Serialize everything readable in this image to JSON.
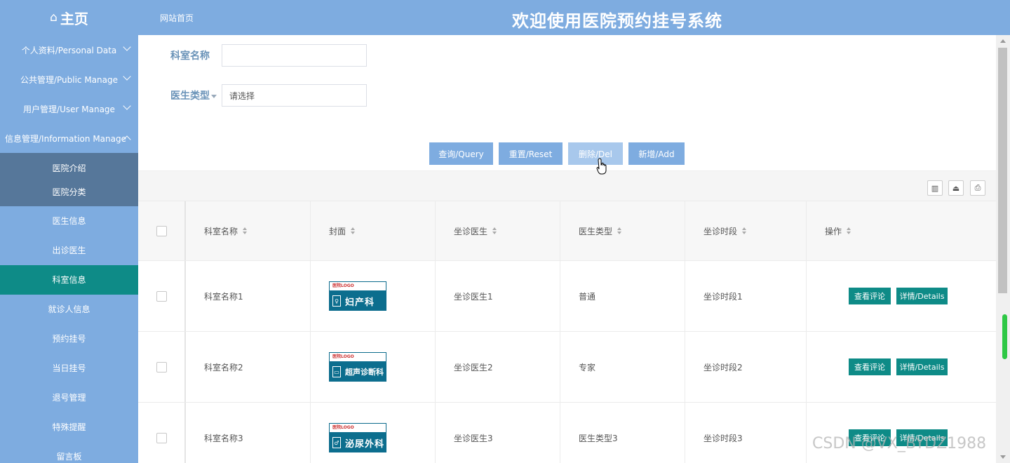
{
  "header": {
    "logo_glyph": "⌂",
    "logo_text": "主页",
    "site_home": "网站首页",
    "title": "欢迎使用医院预约挂号系统"
  },
  "sidebar": {
    "groups": [
      {
        "label": "个人资料/Personal Data"
      },
      {
        "label": "公共管理/Public Manage"
      },
      {
        "label": "用户管理/User Manage"
      },
      {
        "label": "信息管理/Information Manage"
      }
    ],
    "sub_dark": [
      {
        "label": "医院介绍"
      },
      {
        "label": "医院分类"
      }
    ],
    "sub_plain": [
      {
        "label": "医生信息"
      },
      {
        "label": "出诊医生"
      },
      {
        "label": "科室信息"
      },
      {
        "label": "就诊人信息"
      },
      {
        "label": "预约挂号"
      },
      {
        "label": "当日挂号"
      },
      {
        "label": "退号管理"
      },
      {
        "label": "特殊提醒"
      },
      {
        "label": "留言板"
      }
    ]
  },
  "search": {
    "dept_label": "科室名称",
    "dept_value": "",
    "doctor_type_label": "医生类型",
    "doctor_type_value": "请选择"
  },
  "buttons": {
    "query": "查询/Query",
    "reset": "重置/Reset",
    "delete": "删除/Del",
    "add": "新增/Add"
  },
  "toolbar": {
    "columns_icon": "▥",
    "export_icon": "⏏",
    "print_icon": "⎙"
  },
  "table": {
    "headers": {
      "dept": "科室名称",
      "cover": "封面",
      "doctor": "坐诊医生",
      "doctor_type": "医生类型",
      "period": "坐诊时段",
      "ops": "操作"
    },
    "rows": [
      {
        "dept": "科室名称1",
        "cover_logo": "医院LOGO",
        "cover_name": "妇产科",
        "doctor": "坐诊医生1",
        "doctor_type": "普通",
        "period": "坐诊时段1"
      },
      {
        "dept": "科室名称2",
        "cover_logo": "医院LOGO",
        "cover_name": "超声诊断科",
        "doctor": "坐诊医生2",
        "doctor_type": "专家",
        "period": "坐诊时段2"
      },
      {
        "dept": "科室名称3",
        "cover_logo": "医院LOGO",
        "cover_name": "泌尿外科",
        "doctor": "坐诊医生3",
        "doctor_type": "医生类型3",
        "period": "坐诊时段3"
      }
    ],
    "op_review": "查看评论",
    "op_details": "详情/Details"
  },
  "watermark": "CSDN @VX_BYDZ1988",
  "colors": {
    "primary": "#7eace0",
    "sidebar_dark": "#56779a",
    "active": "#0e8b87",
    "scroll_indicator": "#2ec845"
  }
}
